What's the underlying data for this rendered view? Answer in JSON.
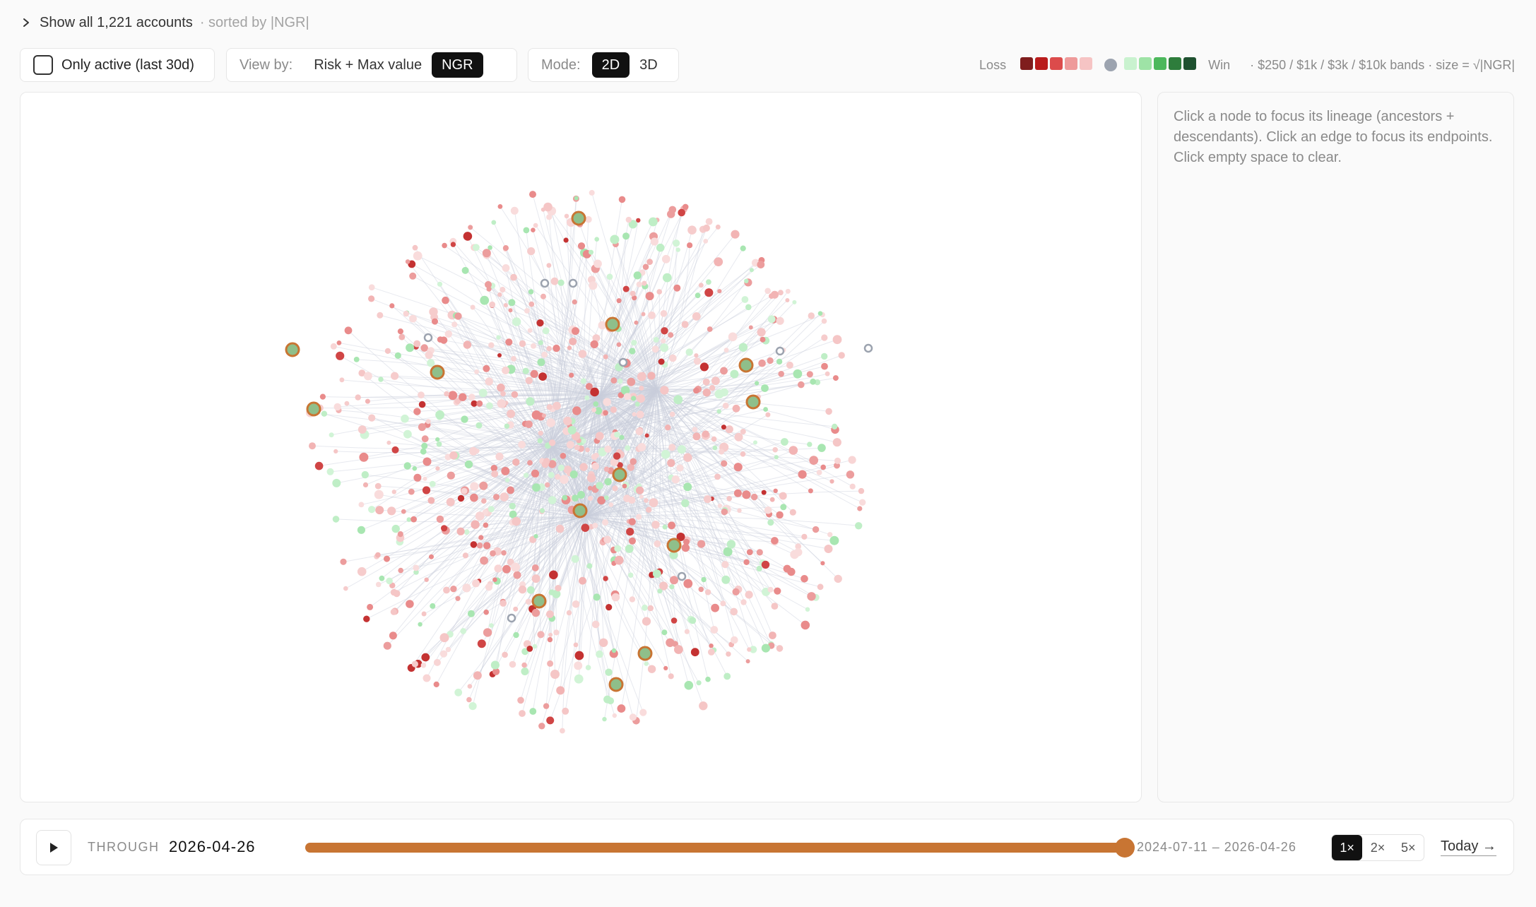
{
  "header": {
    "toggle_label": "Show all 1,221 accounts",
    "sort_note": "· sorted by |NGR|"
  },
  "filters": {
    "only_active_label": "Only active (last 30d)",
    "only_active_checked": false,
    "view_by_label": "View by:",
    "view_options": [
      "Risk + Max value",
      "NGR"
    ],
    "view_selected": "NGR",
    "mode_label": "Mode:",
    "mode_options": [
      "2D",
      "3D"
    ],
    "mode_selected": "2D"
  },
  "legend": {
    "loss_label": "Loss",
    "win_label": "Win",
    "loss_colors": [
      "#7f1d1d",
      "#b91c1c",
      "#dc4b4b",
      "#ee9a9a",
      "#f6c4c4"
    ],
    "neutral_color": "#9ca3af",
    "win_colors": [
      "#c9f2cf",
      "#9ee3a6",
      "#4cb85c",
      "#2e7d3c",
      "#1f5130"
    ],
    "note": "· $250 / $1k / $3k / $10k bands · size = √|NGR|"
  },
  "side_panel": {
    "hint": "Click a node to focus its lineage (ancestors + descendants). Click an edge to focus its endpoints. Click empty space to clear."
  },
  "timeline": {
    "through_label": "THROUGH",
    "current_date": "2026-04-26",
    "range_label": "2024-07-11 – 2026-04-26",
    "progress": 1.0,
    "speeds": [
      "1×",
      "2×",
      "5×"
    ],
    "speed_selected": "1×",
    "today_label": "Today →"
  },
  "icons": {
    "toggle": "chevron-right-icon",
    "play": "play-icon"
  }
}
